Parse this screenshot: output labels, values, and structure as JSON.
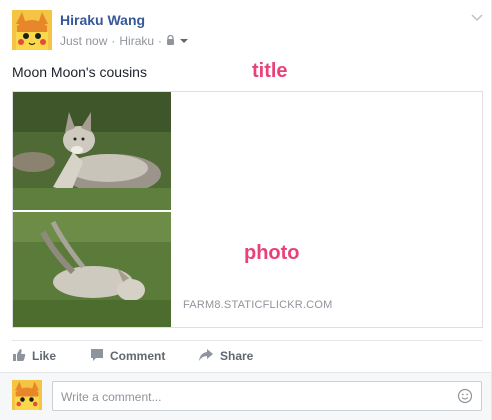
{
  "post": {
    "author": "Hiraku Wang",
    "timestamp": "Just now",
    "separator": "·",
    "audience": "Hiraku",
    "text": "Moon Moon's cousins"
  },
  "annotations": {
    "title_label": "title",
    "photo_label": "photo"
  },
  "attachment": {
    "source": "FARM8.STATICFLICKR.COM"
  },
  "actions": {
    "like_label": "Like",
    "comment_label": "Comment",
    "share_label": "Share"
  },
  "comment_box": {
    "placeholder": "Write a comment..."
  },
  "icons": {
    "privacy": "lock-icon",
    "audience_dropdown": "caret-down-icon",
    "post_menu": "chevron-down-icon",
    "like": "thumbs-up-icon",
    "comment": "speech-bubble-icon",
    "share": "share-arrow-icon",
    "emoji": "smiley-icon"
  },
  "colors": {
    "name_link": "#365899",
    "meta_text": "#90949c",
    "annotation": "#e8427a",
    "action_text": "#616770",
    "avatar_bg": "#f6c445"
  }
}
